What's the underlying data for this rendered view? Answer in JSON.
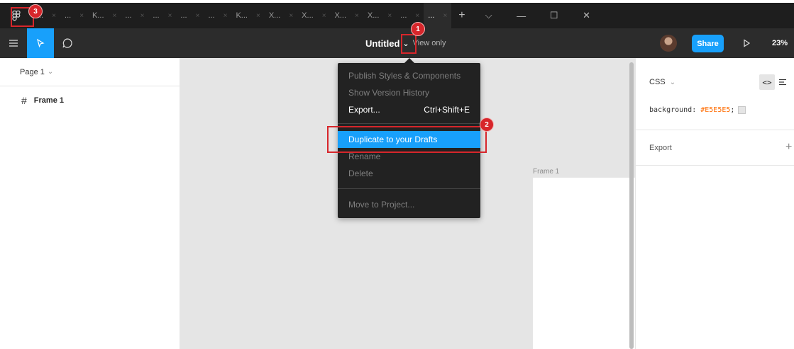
{
  "tabbar": {
    "home_icon": "figma-home-icon",
    "tabs": [
      {
        "label": "..."
      },
      {
        "label": "..."
      },
      {
        "label": "K..."
      },
      {
        "label": "..."
      },
      {
        "label": "..."
      },
      {
        "label": "..."
      },
      {
        "label": "..."
      },
      {
        "label": "K..."
      },
      {
        "label": "X..."
      },
      {
        "label": "X..."
      },
      {
        "label": "X..."
      },
      {
        "label": "X..."
      },
      {
        "label": "..."
      },
      {
        "label": "...",
        "active": true
      }
    ],
    "close_glyph": "×",
    "add_glyph": "+",
    "window_controls": {
      "more": "⌵",
      "minimize": "—",
      "maximize": "☐",
      "close": "✕"
    }
  },
  "toolbar": {
    "doc_title": "Untitled",
    "view_only": "View only",
    "share_label": "Share",
    "zoom": "23%"
  },
  "left_panel": {
    "page_label": "Page 1",
    "layers": [
      {
        "label": "Frame 1",
        "icon": "frame-icon"
      }
    ]
  },
  "canvas": {
    "background": "#E5E5E5",
    "frame_label": "Frame 1"
  },
  "menu": {
    "items": [
      {
        "label": "Publish Styles & Components",
        "shortcut": "",
        "enabled": false
      },
      {
        "label": "Show Version History",
        "shortcut": "",
        "enabled": false
      },
      {
        "label": "Export...",
        "shortcut": "Ctrl+Shift+E",
        "enabled": true
      },
      {
        "label": "Duplicate to your Drafts",
        "shortcut": "",
        "enabled": true,
        "highlighted": true
      },
      {
        "label": "Rename",
        "shortcut": "",
        "enabled": false
      },
      {
        "label": "Delete",
        "shortcut": "",
        "enabled": false
      },
      {
        "label": "Move to Project...",
        "shortcut": "",
        "enabled": false
      }
    ]
  },
  "right_panel": {
    "css_label": "CSS",
    "code_toggle": "<>",
    "css_property": "background:",
    "css_value": "#E5E5E5",
    "css_semicolon": ";",
    "export_label": "Export",
    "export_plus": "+"
  },
  "annotations": [
    "1",
    "2",
    "3"
  ],
  "colors": {
    "accent": "#18A0FB",
    "annotation": "#D7262B",
    "menu_bg": "#222222",
    "toolbar_bg": "#2C2C2C",
    "tabbar_bg": "#1E1E1E",
    "css_value": "#FF6B00"
  }
}
